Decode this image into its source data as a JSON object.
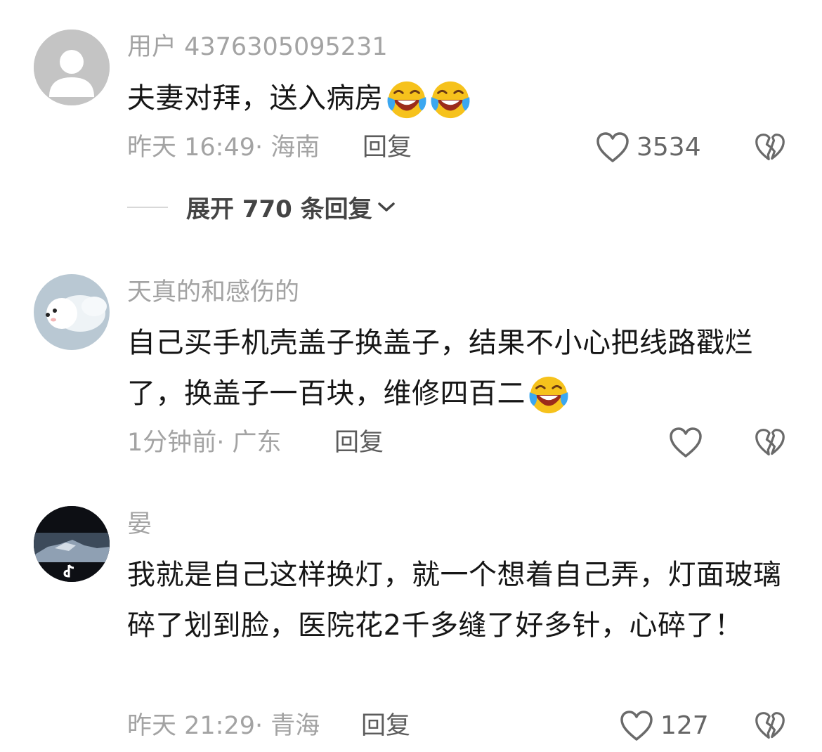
{
  "comments": [
    {
      "username": "用户 4376305095231",
      "text": "夫妻对拜，送入病房",
      "emoji_count": 2,
      "time": "昨天 16:49",
      "location": "· 海南",
      "reply_label": "回复",
      "likes": "3534",
      "expand_label": "展开 770 条回复"
    },
    {
      "username": "天真的和感伤的",
      "text": "自己买手机壳盖子换盖子，结果不小心把线路戳烂了，换盖子一百块，维修四百二",
      "emoji_count": 1,
      "time": "1分钟前",
      "location": "· 广东",
      "reply_label": "回复",
      "likes": ""
    },
    {
      "username": "晏",
      "text": "我就是自己这样换灯，就一个想着自己弄，灯面玻璃碎了划到脸，医院花2千多缝了好多针，心碎了！",
      "emoji_count": 0,
      "time": "昨天 21:29",
      "location": "· 青海",
      "reply_label": "回复",
      "likes": "127"
    }
  ],
  "icons": {
    "like": "heart-outline-icon",
    "dislike": "broken-heart-icon",
    "expand": "chevron-down-icon",
    "emoji": "laughing-crying-emoji"
  },
  "colors": {
    "username": "#a3a3a3",
    "text": "#161616",
    "meta": "#a3a3a3",
    "reply": "#5c5c5c",
    "emoji": "#f5c518"
  }
}
